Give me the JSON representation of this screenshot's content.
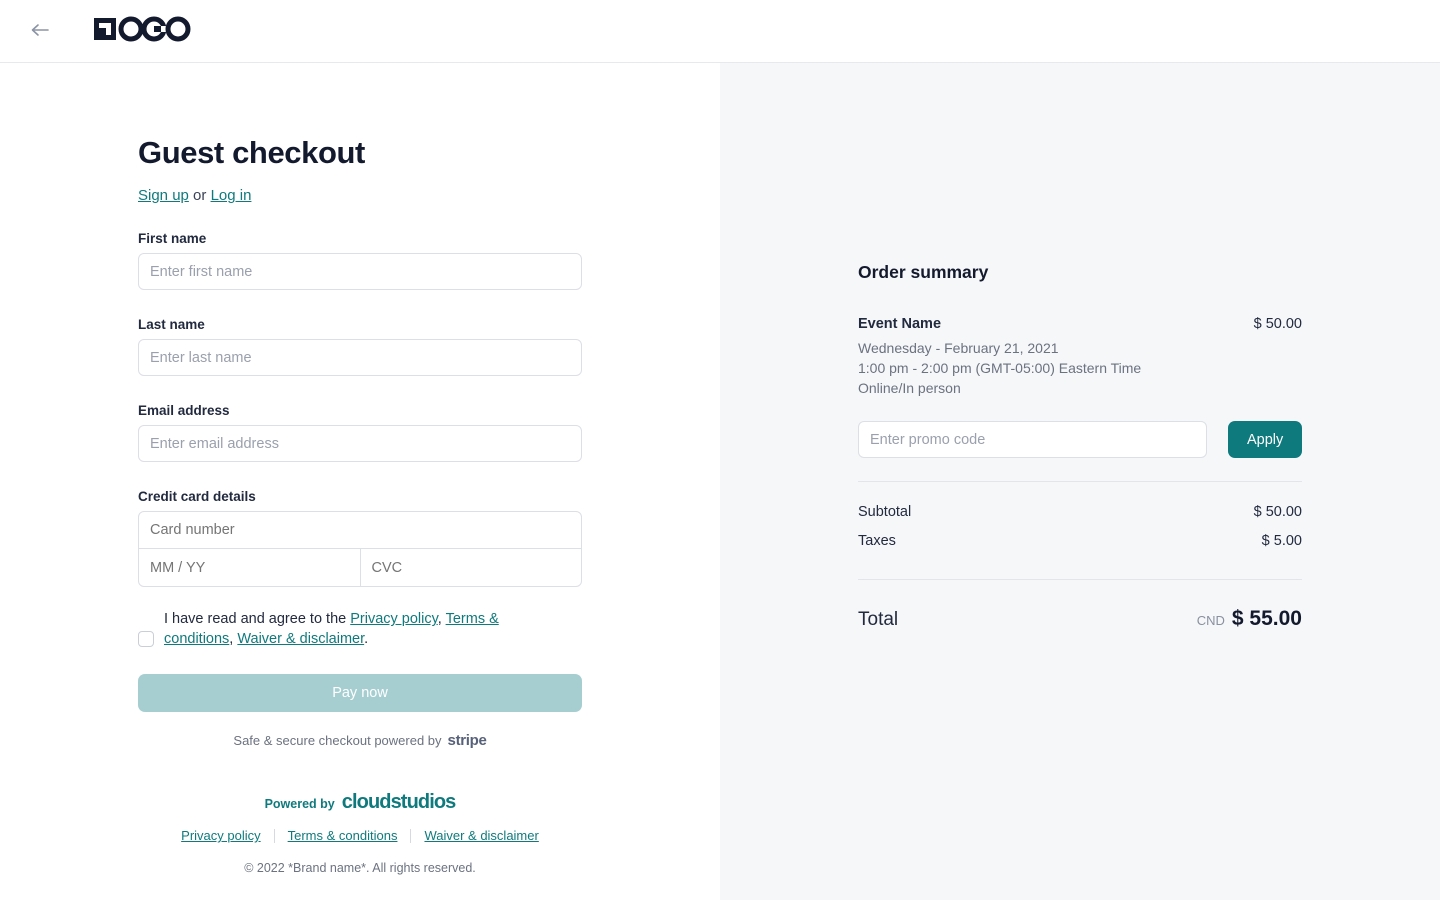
{
  "header": {
    "back_icon": "arrow-left-icon",
    "logo_text": "LOGO"
  },
  "checkout": {
    "title": "Guest checkout",
    "signup_label": "Sign up",
    "or_label": " or ",
    "login_label": "Log in",
    "fields": {
      "first_name_label": "First name",
      "first_name_placeholder": "Enter first name",
      "last_name_label": "Last name",
      "last_name_placeholder": "Enter last name",
      "email_label": "Email address",
      "email_placeholder": "Enter email address",
      "card_label": "Credit card details",
      "card_number_placeholder": "Card number",
      "card_expiry_placeholder": "MM / YY",
      "card_cvc_placeholder": "CVC"
    },
    "agreement": {
      "prefix": "I have read and agree to the ",
      "privacy": "Privacy policy",
      "comma1": ", ",
      "terms": "Terms & conditions",
      "comma2": ", ",
      "waiver": "Waiver & disclaimer",
      "period": ".",
      "checked": false
    },
    "pay_button": "Pay now",
    "secure_text": "Safe & secure checkout powered by",
    "stripe_label": "stripe"
  },
  "footer": {
    "powered_by": "Powered by",
    "brand": "cloudstudios",
    "links": [
      {
        "label": "Privacy policy"
      },
      {
        "label": "Terms & conditions"
      },
      {
        "label": "Waiver & disclaimer"
      }
    ],
    "copyright": "© 2022 *Brand name*. All rights reserved."
  },
  "order_summary": {
    "title": "Order summary",
    "event_name": "Event Name",
    "event_price": "$ 50.00",
    "event_date": "Wednesday - February 21, 2021",
    "event_time": "1:00 pm - 2:00 pm (GMT-05:00) Eastern Time",
    "event_mode": "Online/In person",
    "promo_placeholder": "Enter promo code",
    "apply_label": "Apply",
    "subtotal_label": "Subtotal",
    "subtotal_value": "$ 50.00",
    "taxes_label": "Taxes",
    "taxes_value": "$ 5.00",
    "total_label": "Total",
    "currency": "CND",
    "total_value": "$ 55.00"
  },
  "colors": {
    "accent_teal": "#0f7a7d",
    "accent_teal_disabled": "#a6ced1",
    "panel_bg": "#f6f7f9",
    "text_dark": "#141a2e",
    "text_muted": "#6b7280"
  }
}
